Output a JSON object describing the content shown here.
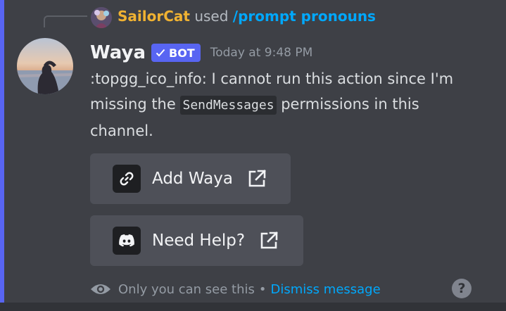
{
  "reply": {
    "username": "SailorCat",
    "verb": "used",
    "command": "/prompt pronouns"
  },
  "message": {
    "username": "Waya",
    "bot_tag": "BOT",
    "timestamp": "Today at 9:48 PM",
    "text_prefix": ":topgg_ico_info: I cannot run this action since I'm missing the",
    "code": "SendMessages",
    "text_suffix": "permissions in this channel."
  },
  "buttons": [
    {
      "label": "Add Waya",
      "icon": "link-icon"
    },
    {
      "label": "Need Help?",
      "icon": "discord-icon"
    }
  ],
  "footer": {
    "notice": "Only you can see this",
    "separator": "•",
    "dismiss": "Dismiss message",
    "help": "?"
  },
  "colors": {
    "accent": "#5865f2",
    "reply_username": "#f0b232",
    "link": "#00a8fc",
    "background": "#3e4046"
  }
}
